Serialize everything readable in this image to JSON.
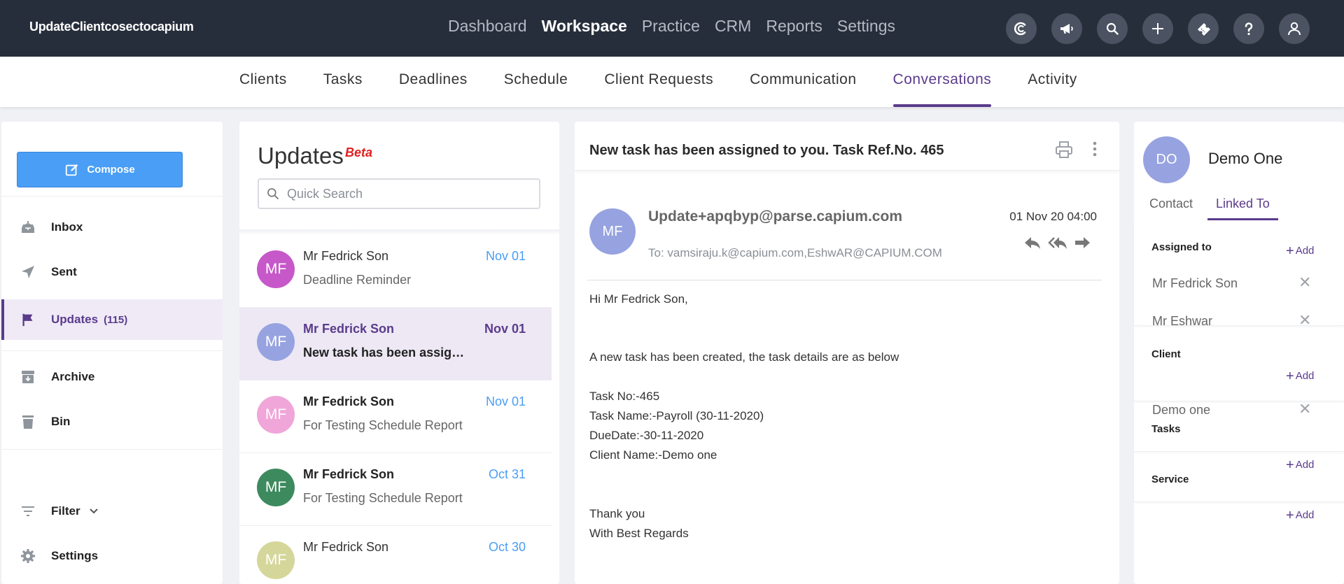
{
  "app": {
    "brand": "UpdateClientcosectocapium"
  },
  "main_nav": [
    "Dashboard",
    "Workspace",
    "Practice",
    "CRM",
    "Reports",
    "Settings"
  ],
  "main_nav_active": "Workspace",
  "top_icons": [
    "capium-logo-icon",
    "megaphone-icon",
    "search-icon",
    "plus-icon",
    "ticket-icon",
    "help-icon",
    "user-icon"
  ],
  "sub_nav": [
    "Clients",
    "Tasks",
    "Deadlines",
    "Schedule",
    "Client Requests",
    "Communication",
    "Conversations",
    "Activity"
  ],
  "sub_nav_active": "Conversations",
  "left": {
    "compose": "Compose",
    "inbox": "Inbox",
    "sent": "Sent",
    "updates": "Updates",
    "updates_count": "(115)",
    "archive": "Archive",
    "bin": "Bin",
    "filter": "Filter",
    "settings": "Settings"
  },
  "list": {
    "title": "Updates",
    "beta": "Beta",
    "search_placeholder": "Quick Search",
    "messages": [
      {
        "initials": "MF",
        "color": "#c658c9",
        "name": "Mr Fedrick Son",
        "subject": "Deadline Reminder",
        "date": "Nov 01"
      },
      {
        "initials": "MF",
        "color": "#97a3e0",
        "name": "Mr Fedrick Son",
        "subject": "New task has been assigned to you. Task Ref.No. 465",
        "date": "Nov 01"
      },
      {
        "initials": "MF",
        "color": "#f0a6d9",
        "name": "Mr Fedrick Son",
        "subject": "For Testing Schedule Report",
        "date": "Nov 01"
      },
      {
        "initials": "MF",
        "color": "#3d8a5e",
        "name": "Mr Fedrick Son",
        "subject": "For Testing Schedule Report",
        "date": "Oct 31"
      },
      {
        "initials": "MF",
        "color": "#d5d69a",
        "name": "Mr Fedrick Son",
        "subject": "",
        "date": "Oct 30"
      }
    ]
  },
  "reader": {
    "title": "New task has been assigned to you. Task Ref.No. 465",
    "sender_initials": "MF",
    "sender": "Update+apqbyp@parse.capium.com",
    "to": "To: vamsiraju.k@capium.com,EshwAR@CAPIUM.COM",
    "date": "01 Nov 20 04:00",
    "body": {
      "greeting": "Hi Mr Fedrick Son,",
      "intro": "A new task has been created, the task details are as below",
      "task_no": "Task No:-465",
      "task_name": "Task Name:-Payroll (30-11-2020)",
      "due": "DueDate:-30-11-2020",
      "client": "Client Name:-Demo one",
      "thanks": "Thank you",
      "regards": "With Best Regards"
    }
  },
  "right": {
    "initials": "DO",
    "name": "Demo One",
    "tab_contact": "Contact",
    "tab_linked": "Linked To",
    "assigned_title": "Assigned to",
    "add": "Add",
    "assigned": [
      "Mr Fedrick Son",
      "Mr Eshwar"
    ],
    "client_title": "Client",
    "client": "Demo one",
    "tasks_title": "Tasks",
    "service_title": "Service"
  }
}
